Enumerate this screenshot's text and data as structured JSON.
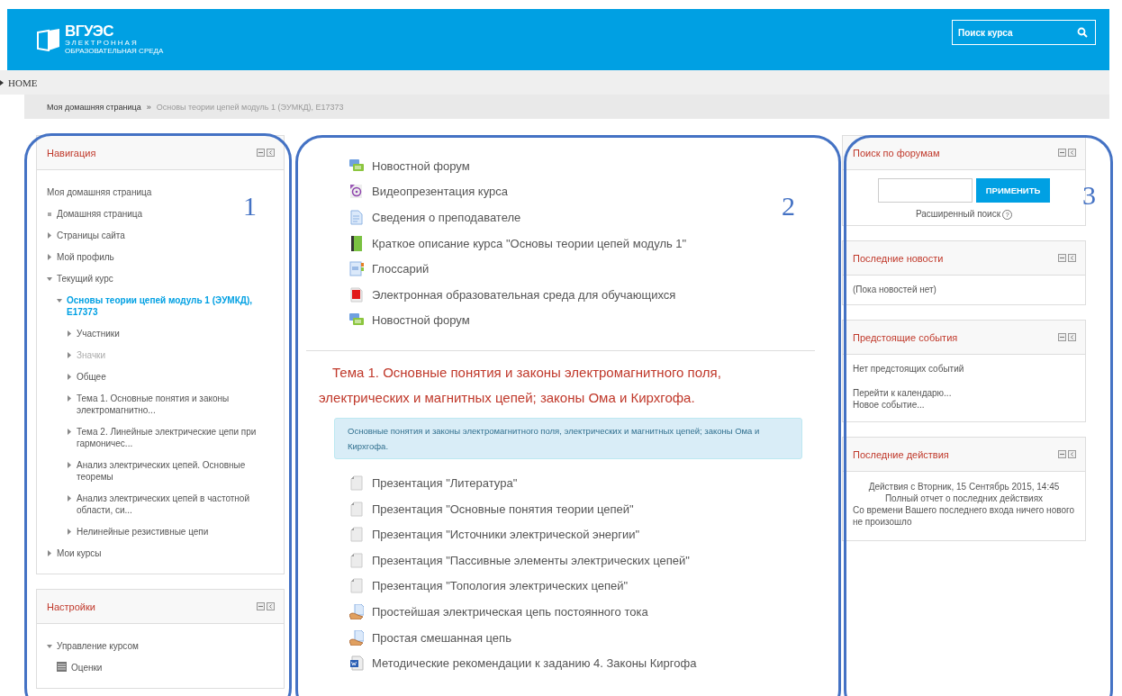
{
  "header": {
    "logo": {
      "title": "ВГУЭС",
      "line_1": "ЭЛЕКТРОННАЯ",
      "line_2": "ОБРАЗОВАТЕЛЬНАЯ СРЕДА"
    },
    "search": {
      "placeholder": "Поиск курса"
    }
  },
  "navbar": {
    "home": "HOME"
  },
  "breadcrumb": [
    {
      "label": "Моя домашняя страница",
      "current": false
    },
    {
      "separator": "»",
      "label": "Основы теории цепей модуль 1 (ЭУМКД), E17373",
      "current": true
    }
  ],
  "navigation": {
    "title": "Навигация",
    "items": [
      {
        "label": "Моя домашняя страница",
        "kind": "root",
        "current": false,
        "dimmed": false
      },
      {
        "label": "Домашняя страница",
        "kind": "leaf",
        "current": false,
        "dimmed": false
      },
      {
        "label": "Страницы сайта",
        "kind": "branch",
        "expanded": false,
        "current": false,
        "dimmed": false
      },
      {
        "label": "Мой профиль",
        "kind": "branch",
        "expanded": false,
        "current": false,
        "dimmed": false
      },
      {
        "label": "Текущий курс",
        "kind": "branch",
        "expanded": true,
        "current": false,
        "dimmed": false,
        "children": [
          {
            "label": "Основы теории цепей модуль 1 (ЭУМКД), E17373",
            "kind": "branch",
            "expanded": true,
            "current": true,
            "dimmed": false,
            "children": [
              {
                "label": "Участники",
                "kind": "branch",
                "expanded": false,
                "current": false,
                "dimmed": false
              },
              {
                "label": "Значки",
                "kind": "branch",
                "expanded": false,
                "current": false,
                "dimmed": true
              },
              {
                "label": "Общее",
                "kind": "branch",
                "expanded": false,
                "current": false,
                "dimmed": false
              },
              {
                "label": "Тема 1. Основные понятия и законы электромагнитно...",
                "kind": "branch",
                "expanded": false,
                "current": false,
                "dimmed": false
              },
              {
                "label": "Тема 2. Линейные электрические цепи при гармоничес...",
                "kind": "branch",
                "expanded": false,
                "current": false,
                "dimmed": false
              },
              {
                "label": "Анализ электрических цепей. Основные теоремы",
                "kind": "branch",
                "expanded": false,
                "current": false,
                "dimmed": false
              },
              {
                "label": "Анализ электрических цепей в частотной области, си...",
                "kind": "branch",
                "expanded": false,
                "current": false,
                "dimmed": false
              },
              {
                "label": "Нелинейные резистивные цепи",
                "kind": "branch",
                "expanded": false,
                "current": false,
                "dimmed": false
              }
            ]
          }
        ]
      },
      {
        "label": "Мои курсы",
        "kind": "branch",
        "expanded": false,
        "current": false,
        "dimmed": false
      }
    ]
  },
  "settings": {
    "title": "Настройки",
    "items": [
      {
        "label": "Управление курсом",
        "kind": "branch",
        "expanded": true,
        "children": [
          {
            "label": "Оценки",
            "kind": "grades"
          }
        ]
      }
    ]
  },
  "course": {
    "general": [
      {
        "kind": "forum",
        "label": "Новостной форум"
      },
      {
        "kind": "video",
        "label": "Видеопрезентация курса"
      },
      {
        "kind": "page",
        "label": "Сведения о преподавателе"
      },
      {
        "kind": "book",
        "label": "Краткое описание курса \"Основы теории цепей модуль 1\""
      },
      {
        "kind": "glossary",
        "label": "Глоссарий"
      },
      {
        "kind": "pdf",
        "label": "Электронная образовательная среда для обучающихся"
      },
      {
        "kind": "forum",
        "label": "Новостной форум"
      }
    ],
    "section": {
      "title": "Тема 1. Основные понятия и законы электромагнитного поля, электрических и магнитных цепей; законы Ома и Кирхгофа.",
      "summary": "Основные понятия и законы электромагнитного поля, электрических и магнитных цепей; законы Ома и Кирхгофа.",
      "activities": [
        {
          "kind": "file",
          "label": "Презентация \"Литература\""
        },
        {
          "kind": "file",
          "label": "Презентация \"Основные понятия теории цепей\""
        },
        {
          "kind": "file",
          "label": "Презентация \"Источники электрической энергии\""
        },
        {
          "kind": "file",
          "label": "Презентация \"Пассивные элементы электрических цепей\""
        },
        {
          "kind": "file",
          "label": "Презентация \"Топология электрических цепей\""
        },
        {
          "kind": "assignment",
          "label": "Простейшая электрическая цепь постоянного тока"
        },
        {
          "kind": "assignment",
          "label": "Простая смешанная цепь"
        },
        {
          "kind": "word",
          "label": "Методические рекомендации к заданию 4. Законы Киргофа"
        }
      ]
    }
  },
  "blocks": [
    {
      "kind": "forum_search",
      "title": "Поиск по форумам",
      "button": "ПРИМЕНИТЬ",
      "link": "Расширенный поиск",
      "help": "?"
    },
    {
      "kind": "text",
      "title": "Последние новости",
      "lines": [
        "(Пока новостей нет)"
      ]
    },
    {
      "kind": "events",
      "title": "Предстоящие события",
      "lines": [
        "Нет предстоящих событий"
      ],
      "links": [
        "Перейти к календарю...",
        "Новое событие..."
      ]
    },
    {
      "kind": "activity",
      "title": "Последние действия",
      "centered": [
        "Действия с Вторник, 15 Сентябрь 2015, 14:45",
        "Полный отчет о последних действиях"
      ],
      "lines": [
        "Со времени Вашего последнего входа ничего нового не произошло"
      ]
    }
  ],
  "annotations": [
    {
      "label": "1"
    },
    {
      "label": "2"
    },
    {
      "label": "3"
    }
  ]
}
